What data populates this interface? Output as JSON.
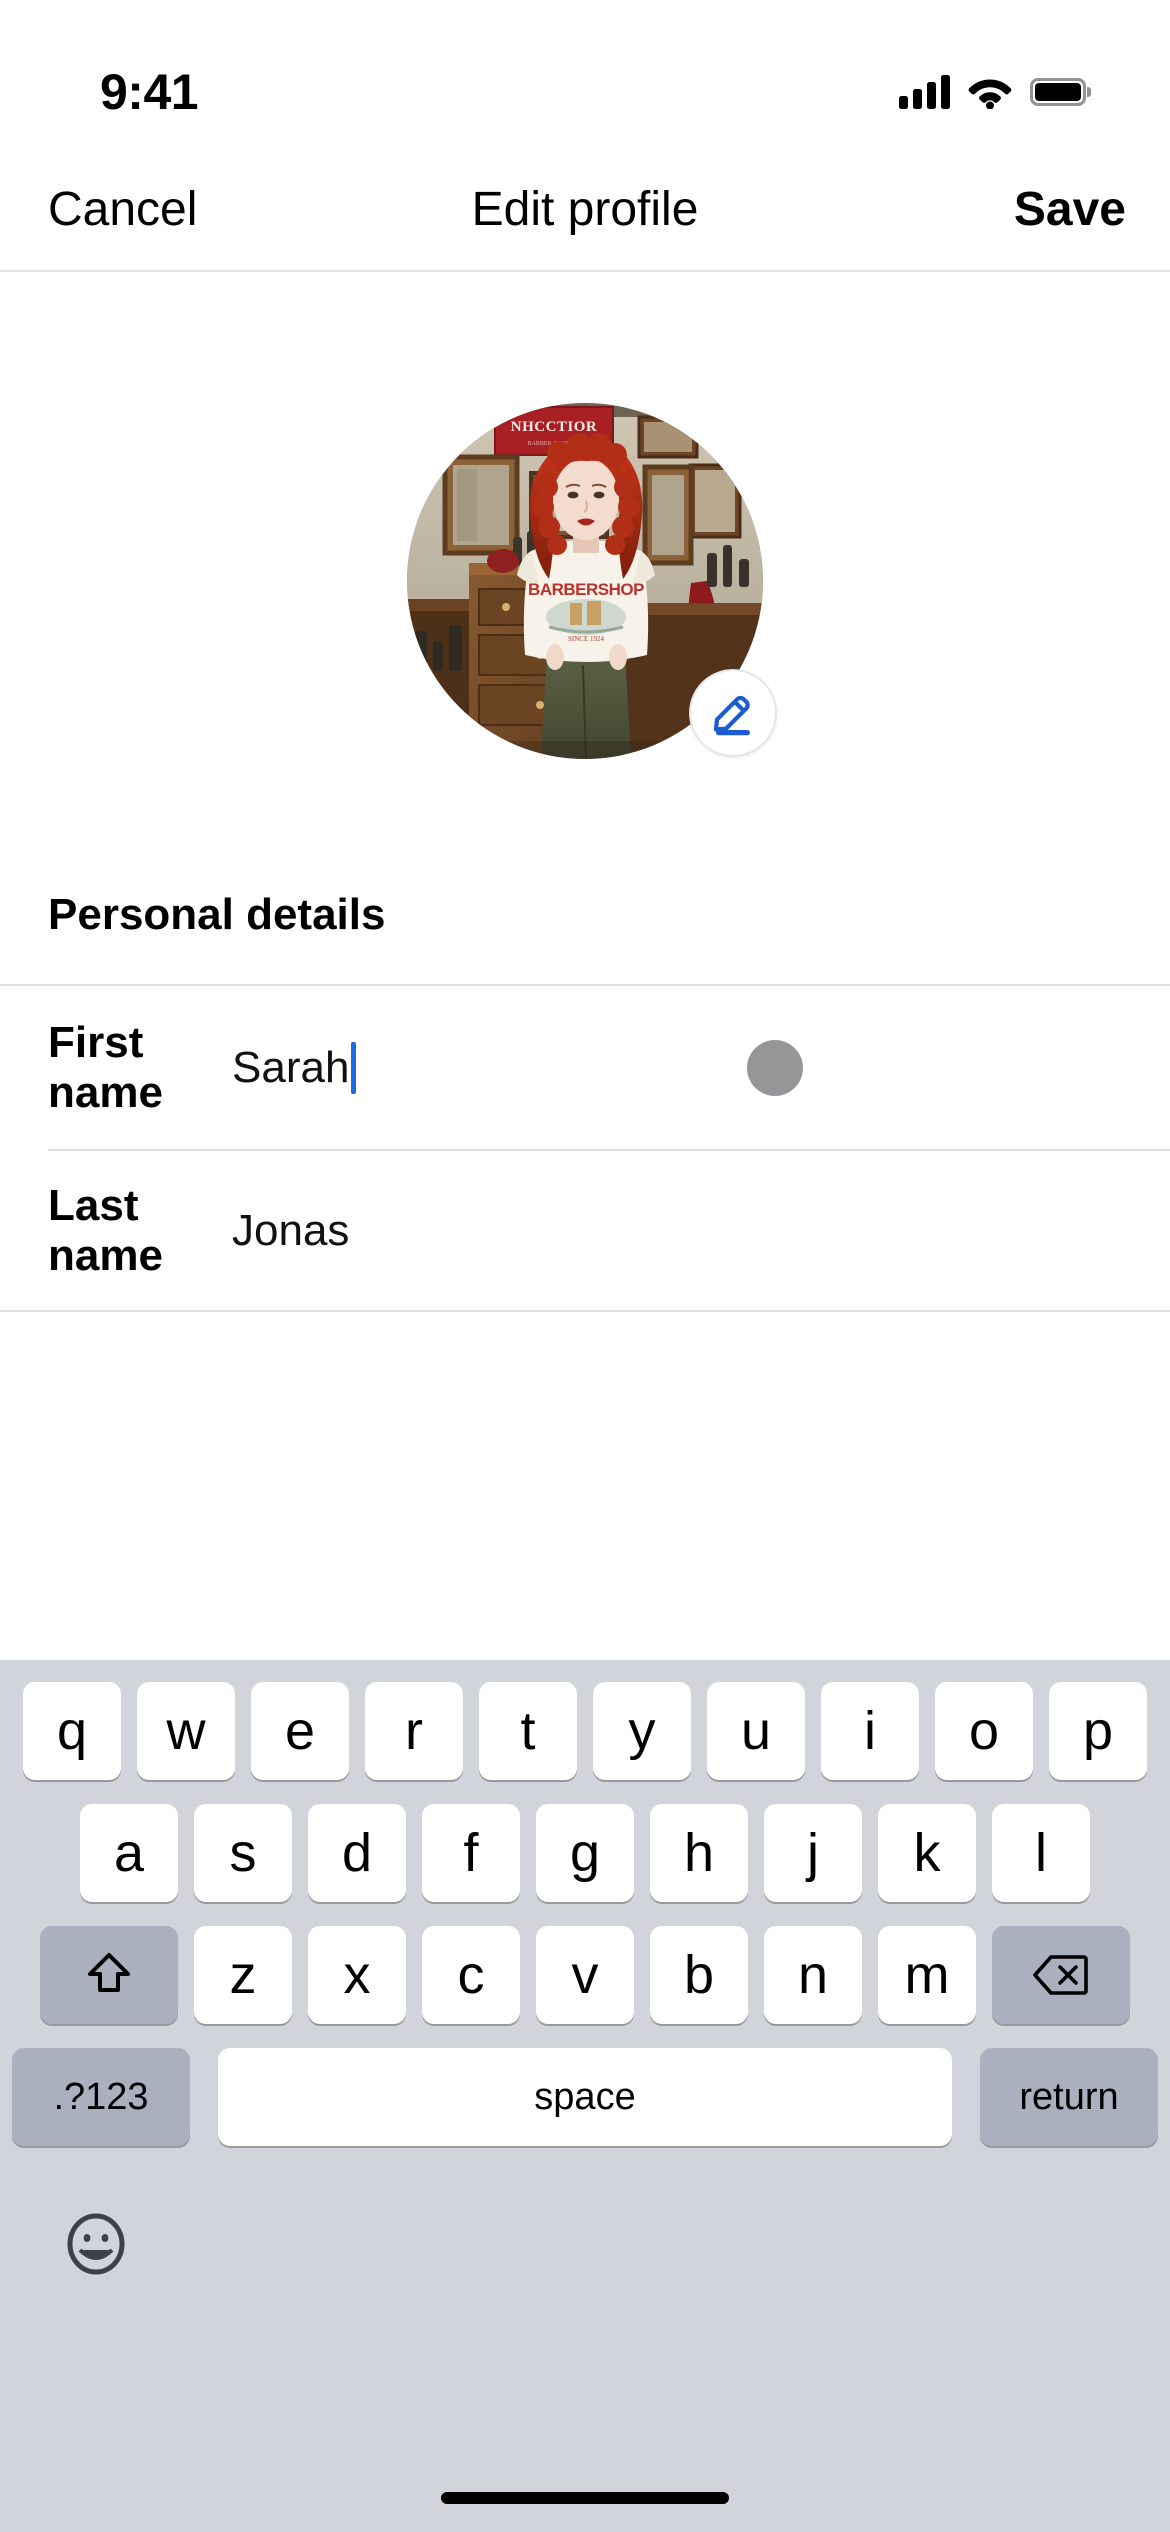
{
  "status_bar": {
    "time": "9:41",
    "signal_icon": "cellular-signal-icon",
    "wifi_icon": "wifi-icon",
    "battery_icon": "battery-full-icon"
  },
  "nav_bar": {
    "cancel_label": "Cancel",
    "title": "Edit profile",
    "save_label": "Save"
  },
  "avatar": {
    "name": "profile-photo",
    "alt": "Woman with red curly hair standing in a barbershop wearing a white graphic t-shirt and olive green trousers",
    "sign_text": "NHCCTIOR",
    "shirt_text": "BARBERSHOP",
    "edit_badge_icon": "pencil-edit-icon",
    "edit_badge_color": "#1b5bd4"
  },
  "section": {
    "header": "Personal details"
  },
  "fields": [
    {
      "label": "First name",
      "value": "Sarah",
      "placeholder": "First name",
      "focused": true,
      "has_clear_button": true,
      "clear_button_color": "#969699",
      "caret_color": "#1b6ae8"
    },
    {
      "label": "Last name",
      "value": "Jonas",
      "placeholder": "Last name",
      "focused": false,
      "has_clear_button": false
    }
  ],
  "keyboard": {
    "background": "#d1d4da",
    "row1": [
      "q",
      "w",
      "e",
      "r",
      "t",
      "y",
      "u",
      "i",
      "o",
      "p"
    ],
    "row2": [
      "a",
      "s",
      "d",
      "f",
      "g",
      "h",
      "j",
      "k",
      "l"
    ],
    "row3": [
      "z",
      "x",
      "c",
      "v",
      "b",
      "n",
      "m"
    ],
    "shift_icon": "shift-arrow-icon",
    "delete_icon": "backspace-delete-icon",
    "numbers_label": ".?123",
    "space_label": "space",
    "return_label": "return",
    "emoji_icon": "emoji-smiley-icon"
  },
  "home_indicator": {
    "name": "home-indicator"
  }
}
